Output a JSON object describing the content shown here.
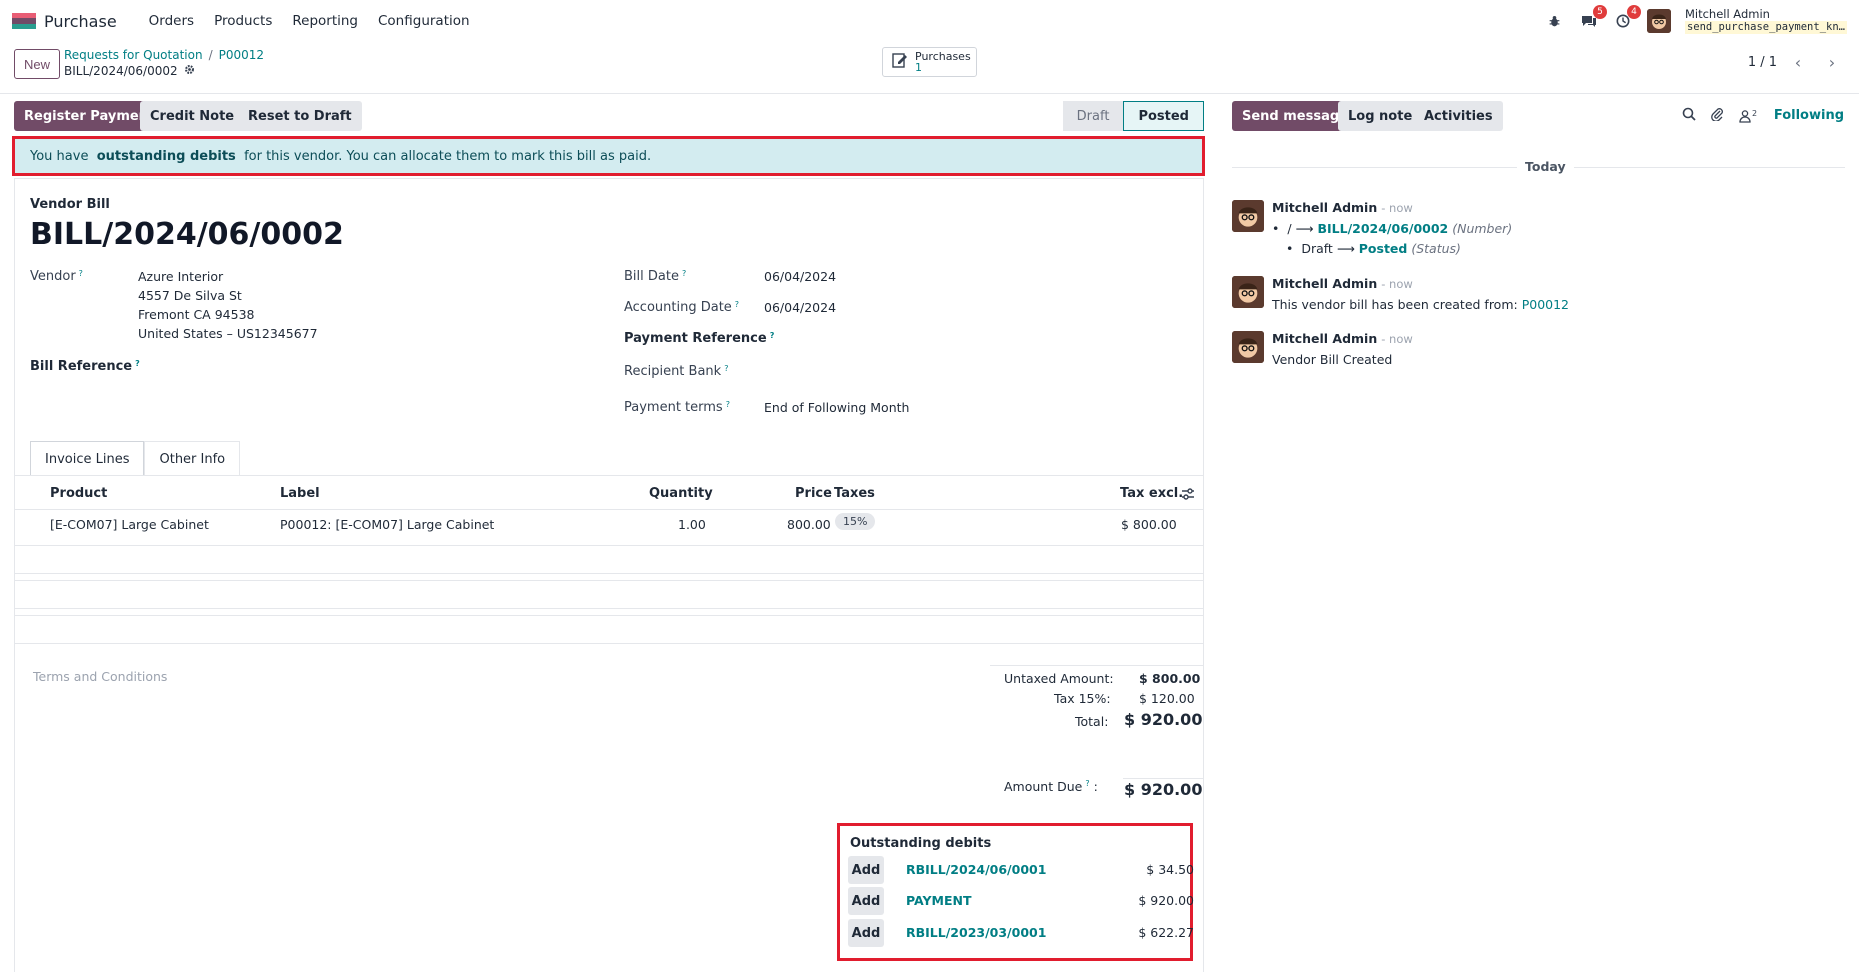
{
  "navbar": {
    "app_name": "Purchase",
    "menu": [
      "Orders",
      "Products",
      "Reporting",
      "Configuration"
    ],
    "chat_count": "5",
    "activity_count": "4",
    "user_name": "Mitchell Admin",
    "user_db": "send_purchase_payment_kn…"
  },
  "control": {
    "new_label": "New",
    "breadcrumb": [
      "Requests for Quotation",
      "P00012"
    ],
    "record_name": "BILL/2024/06/0002",
    "smart_button_label": "Purchases",
    "smart_button_count": "1",
    "pager": "1 / 1"
  },
  "statusbar": {
    "register_payment": "Register Payment",
    "credit_note": "Credit Note",
    "reset_to_draft": "Reset to Draft",
    "stages": [
      "Draft",
      "Posted"
    ],
    "active_stage": "Posted"
  },
  "alert": {
    "prefix": "You have ",
    "bold": "outstanding debits",
    "suffix": " for this vendor. You can allocate them to mark this bill as paid."
  },
  "form": {
    "doc_type": "Vendor Bill",
    "doc_name": "BILL/2024/06/0002",
    "vendor_label": "Vendor",
    "vendor_name": "Azure Interior",
    "vendor_address": [
      "4557 De Silva St",
      "Fremont CA 94538",
      "United States – US12345677"
    ],
    "bill_reference_label": "Bill Reference",
    "bill_date_label": "Bill Date",
    "bill_date": "06/04/2024",
    "accounting_date_label": "Accounting Date",
    "accounting_date": "06/04/2024",
    "payment_reference_label": "Payment Reference",
    "recipient_bank_label": "Recipient Bank",
    "payment_terms_label": "Payment terms",
    "payment_terms": "End of Following Month"
  },
  "tabs": [
    "Invoice Lines",
    "Other Info"
  ],
  "lines": {
    "headers": {
      "product": "Product",
      "label": "Label",
      "quantity": "Quantity",
      "price": "Price",
      "taxes": "Taxes",
      "tax_excl": "Tax excl."
    },
    "rows": [
      {
        "product": "[E-COM07] Large Cabinet",
        "label": "P00012: [E-COM07] Large Cabinet",
        "quantity": "1.00",
        "price": "800.00",
        "tax": "15%",
        "subtotal": "$ 800.00"
      }
    ]
  },
  "terms_placeholder": "Terms and Conditions",
  "totals": {
    "untaxed_label": "Untaxed Amount:",
    "untaxed": "$ 800.00",
    "tax_label": "Tax 15%:",
    "tax": "$ 120.00",
    "total_label": "Total:",
    "total": "$ 920.00",
    "amount_due_label": "Amount Due",
    "amount_due": "$ 920.00"
  },
  "outstanding": {
    "title": "Outstanding debits",
    "add_label": "Add",
    "items": [
      {
        "ref": "RBILL/2024/06/0001",
        "amount": "$ 34.50"
      },
      {
        "ref": "PAYMENT",
        "amount": "$ 920.00"
      },
      {
        "ref": "RBILL/2023/03/0001",
        "amount": "$ 622.27"
      }
    ]
  },
  "chatter": {
    "send_message": "Send message",
    "log_note": "Log note",
    "activities": "Activities",
    "followers_count": "2",
    "following": "Following",
    "today": "Today",
    "messages": [
      {
        "author": "Mitchell Admin",
        "time": "- now",
        "line1_old": "/",
        "line1_new": "BILL/2024/06/0002",
        "line1_field": "(Number)",
        "line2_old": "Draft",
        "line2_new": "Posted",
        "line2_field": "(Status)"
      },
      {
        "author": "Mitchell Admin",
        "time": "- now",
        "text": "This vendor bill has been created from: ",
        "link": "P00012"
      },
      {
        "author": "Mitchell Admin",
        "time": "- now",
        "text": "Vendor Bill Created"
      }
    ]
  },
  "colors": {
    "brand": "#714b67",
    "link": "#017e84",
    "alert_bg": "#d3ecf0",
    "highlight": "#e11d2e"
  }
}
